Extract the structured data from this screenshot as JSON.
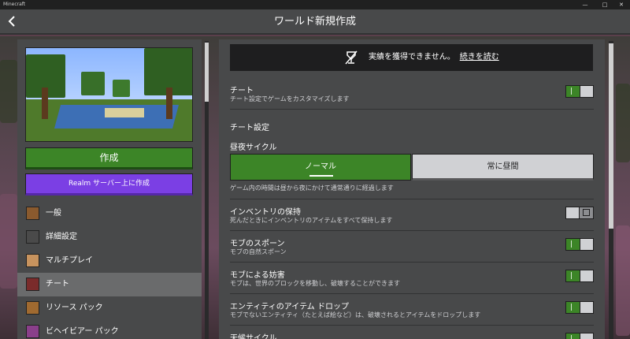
{
  "titlebar": {
    "app_name": "Minecraft",
    "minimize": "—",
    "maximize": "□",
    "close": "✕"
  },
  "header": {
    "title": "ワールド新規作成",
    "back_icon": "chevron-left-icon"
  },
  "left": {
    "create_label": "作成",
    "realm_label": "Realm サーバー上に作成",
    "nav": [
      {
        "label": "一般",
        "icon": "general-icon"
      },
      {
        "label": "詳細設定",
        "icon": "advanced-icon"
      },
      {
        "label": "マルチプレイ",
        "icon": "multiplayer-icon"
      },
      {
        "label": "チート",
        "icon": "cheats-icon",
        "active": true
      },
      {
        "label": "リソース パック",
        "icon": "resource-pack-icon"
      },
      {
        "label": "ビヘイビアー パック",
        "icon": "behavior-pack-icon"
      }
    ]
  },
  "right": {
    "banner": {
      "text": "実績を獲得できません。",
      "link": "続きを読む"
    },
    "cheats": {
      "title": "チート",
      "desc": "チート設定でゲームをカスタマイズします",
      "state": "on"
    },
    "section": "チート設定",
    "daylight": {
      "title": "昼夜サイクル",
      "options": [
        "ノーマル",
        "常に昼間"
      ],
      "selected": "ノーマル",
      "desc": "ゲーム内の時間は昼から夜にかけて通常通りに経過します"
    },
    "keep_inventory": {
      "title": "インベントリの保持",
      "desc": "死んだときにインベントリのアイテムをすべて保持します",
      "state": "off"
    },
    "mob_spawning": {
      "title": "モブのスポーン",
      "desc": "モブの自然スポーン",
      "state": "on"
    },
    "mob_griefing": {
      "title": "モブによる妨害",
      "desc": "モブは、世界のブロックを移動し、破壊することができます",
      "state": "on"
    },
    "entity_drops": {
      "title": "エンティティのアイテム ドロップ",
      "desc": "モブでないエンティティ（たとえば絵など）は、破壊されるとアイテムをドロップします",
      "state": "on"
    },
    "weather_cycle": {
      "title": "天候サイクル",
      "state": "on"
    }
  },
  "colors": {
    "accent_green": "#3c8527",
    "realm_purple": "#7b3fe4",
    "panel": "#48494a"
  }
}
